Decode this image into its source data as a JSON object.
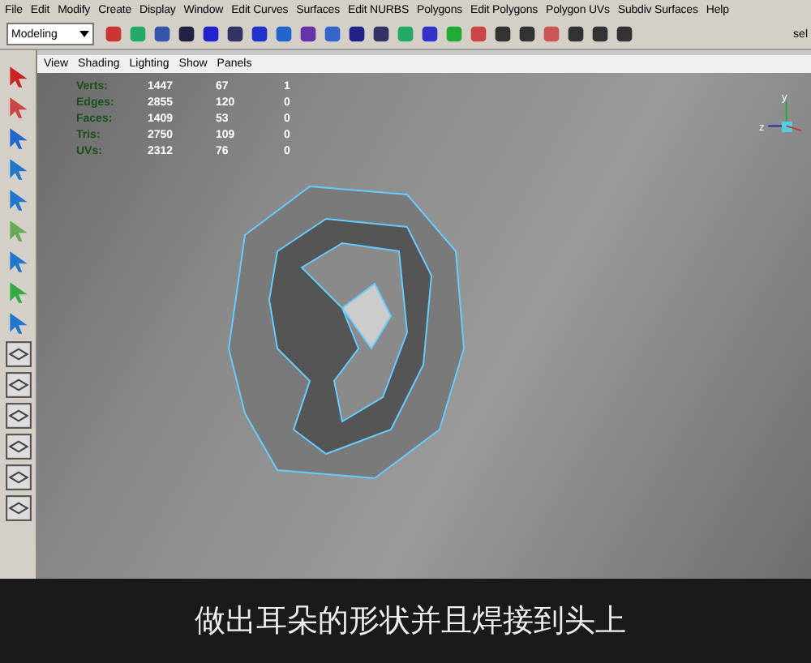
{
  "menu_bar": [
    "File",
    "Edit",
    "Modify",
    "Create",
    "Display",
    "Window",
    "Edit Curves",
    "Surfaces",
    "Edit NURBS",
    "Polygons",
    "Edit Polygons",
    "Polygon UVs",
    "Subdiv Surfaces",
    "Help"
  ],
  "toolbar": {
    "mode": "Modeling",
    "tail": "sel"
  },
  "panel_menu": [
    "View",
    "Shading",
    "Lighting",
    "Show",
    "Panels"
  ],
  "hud": [
    {
      "label": "Verts:",
      "values": [
        "1447",
        "67",
        "1"
      ]
    },
    {
      "label": "Edges:",
      "values": [
        "2855",
        "120",
        "0"
      ]
    },
    {
      "label": "Faces:",
      "values": [
        "1409",
        "53",
        "0"
      ]
    },
    {
      "label": "Tris:",
      "values": [
        "2750",
        "109",
        "0"
      ]
    },
    {
      "label": "UVs:",
      "values": [
        "2312",
        "76",
        "0"
      ]
    }
  ],
  "axis": {
    "y": "y",
    "z": "z"
  },
  "subtitle": "做出耳朵的形状并且焊接到头上"
}
